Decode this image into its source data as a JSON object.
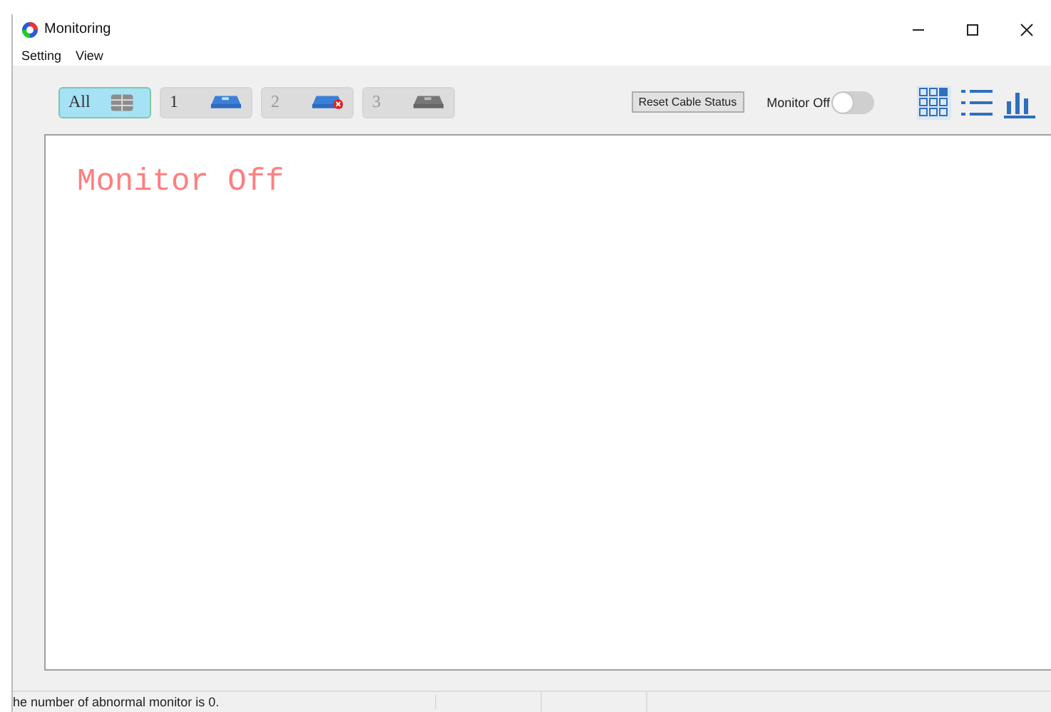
{
  "window": {
    "title": "Monitoring"
  },
  "menu": [
    {
      "label": "Setting"
    },
    {
      "label": "View"
    }
  ],
  "devices": [
    {
      "label": "All",
      "kind": "all",
      "selected": true
    },
    {
      "label": "1",
      "kind": "normal",
      "selected": false
    },
    {
      "label": "2",
      "kind": "error",
      "selected": false
    },
    {
      "label": "3",
      "kind": "offline",
      "selected": false
    }
  ],
  "reset_button": {
    "label": "Reset Cable Status"
  },
  "monitor_switch": {
    "label": "Monitor Off",
    "on": false
  },
  "views": [
    {
      "kind": "grid",
      "selected": true
    },
    {
      "kind": "list",
      "selected": false
    },
    {
      "kind": "chart",
      "selected": false
    }
  ],
  "content": {
    "message": "Monitor Off"
  },
  "status_bar": {
    "message": "he number of abnormal monitor is 0."
  }
}
